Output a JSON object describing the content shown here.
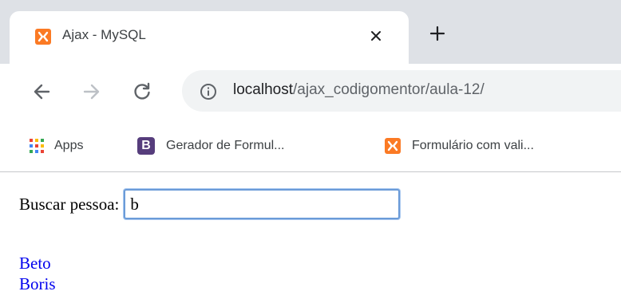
{
  "browser": {
    "tab": {
      "title": "Ajax - MySQL",
      "favicon": "xampp-icon"
    },
    "address": {
      "host": "localhost",
      "path": "/ajax_codigomentor/aula-12/"
    },
    "bookmarks": [
      {
        "label": "Apps",
        "icon": "apps-grid-icon"
      },
      {
        "label": "Gerador de Formul...",
        "icon": "bootstrap-icon",
        "icon_letter": "B"
      },
      {
        "label": "Formulário com vali...",
        "icon": "xampp-icon"
      }
    ]
  },
  "page": {
    "search": {
      "label": "Buscar pessoa:",
      "value": "b"
    },
    "results": [
      "Beto",
      "Boris"
    ]
  },
  "colors": {
    "tabstrip": "#dee1e6",
    "omnibox": "#f1f3f4",
    "xampp_orange": "#fb7a24",
    "bootstrap_purple": "#563d7c",
    "link": "#0000ee",
    "input_focus": "#6b9bd8"
  }
}
